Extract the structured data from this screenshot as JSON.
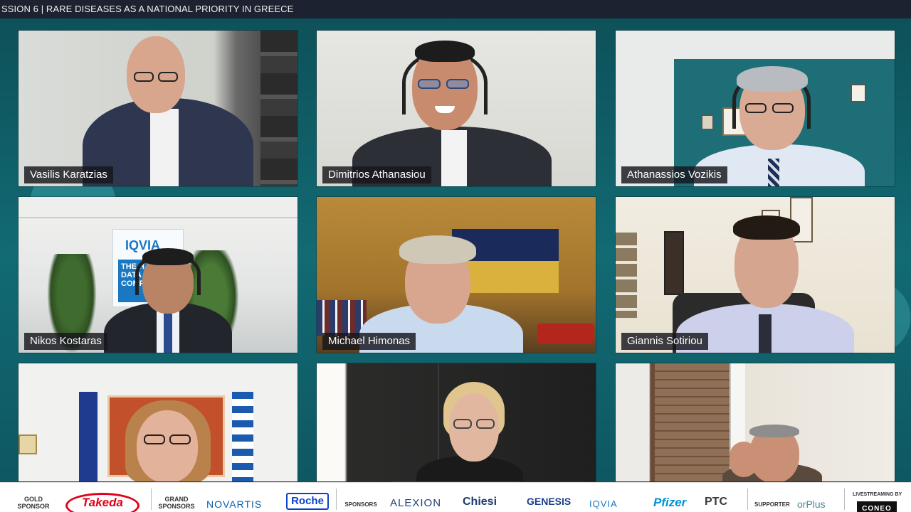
{
  "session": {
    "title": "SSION 6 | RARE DISEASES AS A NATIONAL PRIORITY IN GREECE"
  },
  "participants": [
    {
      "name": "Vasilis Karatzias"
    },
    {
      "name": "Dimitrios Athanasiou"
    },
    {
      "name": "Athanassios Vozikis"
    },
    {
      "name": "Nikos Kostaras"
    },
    {
      "name": "Michael Himonas"
    },
    {
      "name": "Giannis Sotiriou"
    },
    {
      "name": "",
      "name_visible": false
    },
    {
      "name": "",
      "name_visible": false
    },
    {
      "name": "",
      "name_visible": false
    }
  ],
  "background_text": {
    "iqvia_banner": "IQVIA",
    "iqvia_banner_lines": [
      "THE H",
      "DATA",
      "COMPA"
    ]
  },
  "sponsors": {
    "gold_label": "GOLD SPONSOR",
    "gold": [
      "Takeda"
    ],
    "grand_label": "GRAND SPONSORS",
    "grand": [
      "NOVARTIS",
      "Roche"
    ],
    "sponsors_label": "SPONSORS",
    "sponsors": [
      "ALEXION",
      "Chiesi",
      "GENESIS",
      "IQVIA",
      "Pfizer",
      "PTC"
    ],
    "supporter_label": "SUPPORTER",
    "supporter": [
      "orPlus"
    ],
    "livestream_label": "LIVESTREAMING BY",
    "livestream": [
      "CONEO"
    ]
  },
  "colors": {
    "background": "#0f5a62",
    "title_bar": "#1d2230",
    "name_tag": "#16161c",
    "takeda_red": "#e0001a",
    "roche_blue": "#0b41cd",
    "pfizer_blue": "#0093d0",
    "genesis_blue": "#1a3e8c"
  }
}
